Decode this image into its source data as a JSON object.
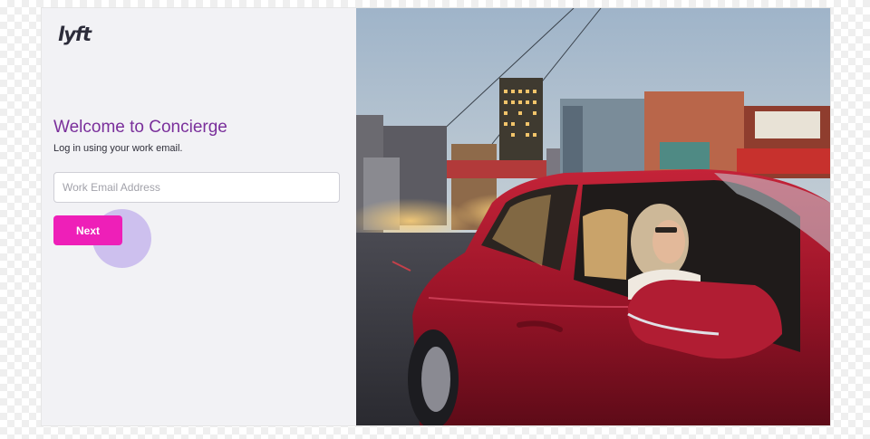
{
  "brand": {
    "logo_text": "lyft"
  },
  "login": {
    "title": "Welcome to Concierge",
    "subtitle": "Log in using your work email.",
    "email_placeholder": "Work Email Address",
    "email_value": "",
    "next_label": "Next"
  },
  "hero": {
    "icon": "woman-in-red-car-photo"
  },
  "colors": {
    "accent": "#ee1fb8",
    "title": "#7a2f9b",
    "panel": "#f2f2f5",
    "car": "#a8182b"
  }
}
